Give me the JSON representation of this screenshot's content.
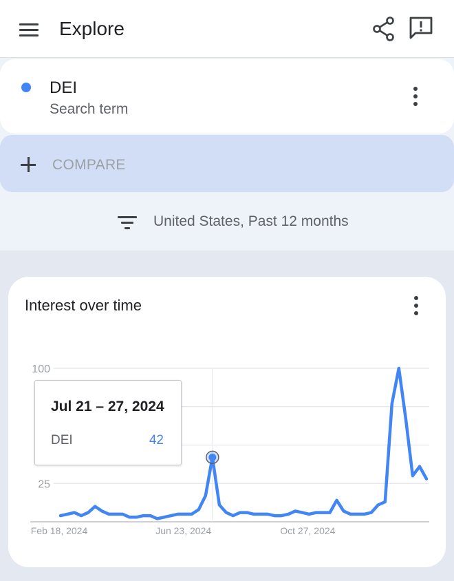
{
  "appbar": {
    "title": "Explore",
    "menu_icon": "hamburger-menu-icon",
    "share_icon": "share-icon",
    "feedback_icon": "feedback-icon"
  },
  "term_card": {
    "name": "DEI",
    "type": "Search term",
    "dot_color": "#4285f4",
    "more_icon": "more-vert-icon"
  },
  "compare": {
    "label": "COMPARE",
    "icon": "plus-icon"
  },
  "filter": {
    "icon": "filter-list-icon",
    "text": "United States, Past 12 months"
  },
  "chart_card": {
    "title": "Interest over time",
    "more_icon": "more-vert-icon"
  },
  "tooltip": {
    "date": "Jul 21 – 27, 2024",
    "term": "DEI",
    "value": "42"
  },
  "colors": {
    "accent": "#4285f4",
    "compare_bg": "#d1def5",
    "page_bg": "#eef2f9"
  },
  "chart_data": {
    "type": "line",
    "title": "Interest over time",
    "xlabel": "",
    "ylabel": "",
    "ylim": [
      0,
      100
    ],
    "y_ticks": [
      "25",
      "50",
      "75",
      "100"
    ],
    "x_ticks": [
      "Feb 18, 2024",
      "Jun 23, 2024",
      "Oct 27, 2024"
    ],
    "grid": true,
    "highlight_index": 22,
    "series": [
      {
        "name": "DEI",
        "color": "#4285f4",
        "values": [
          4,
          5,
          6,
          4,
          6,
          10,
          7,
          5,
          5,
          5,
          3,
          3,
          4,
          4,
          2,
          3,
          4,
          5,
          5,
          5,
          8,
          17,
          42,
          11,
          6,
          4,
          6,
          6,
          5,
          5,
          5,
          4,
          4,
          5,
          7,
          6,
          5,
          6,
          6,
          6,
          14,
          7,
          5,
          5,
          5,
          6,
          11,
          13,
          77,
          100,
          67,
          30,
          36,
          28
        ]
      }
    ]
  }
}
